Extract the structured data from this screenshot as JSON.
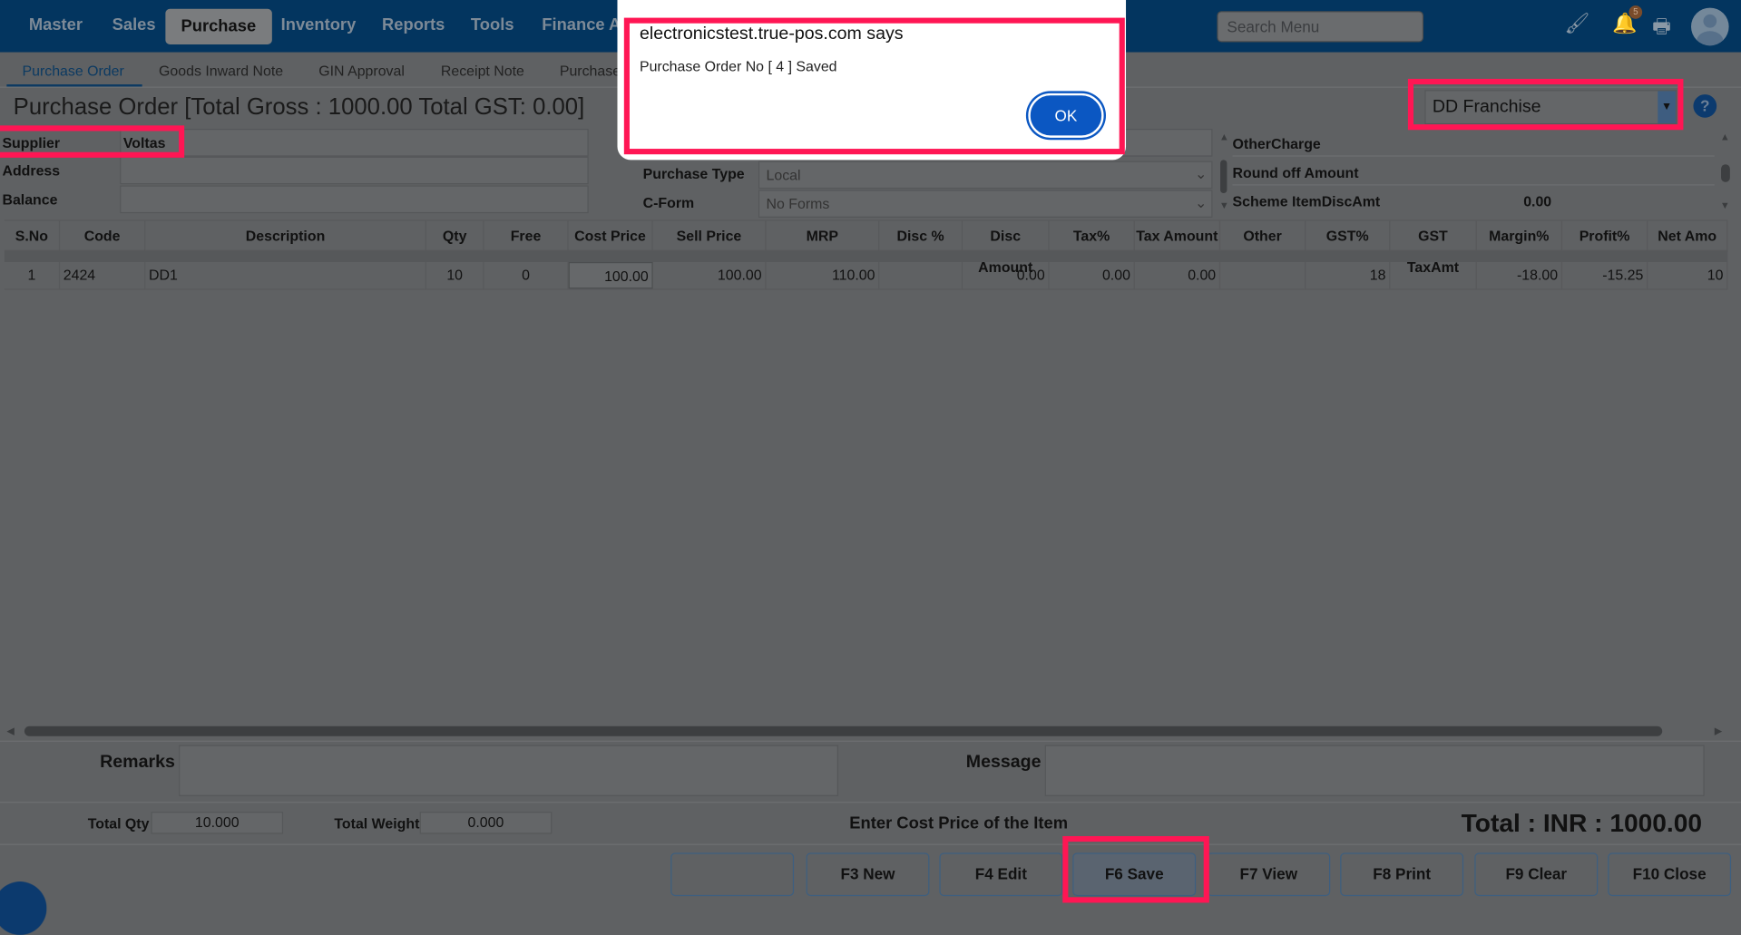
{
  "nav": {
    "items": [
      "Master",
      "Sales",
      "Purchase",
      "Inventory",
      "Reports",
      "Tools",
      "Finance An"
    ],
    "active": "Purchase",
    "search_placeholder": "Search Menu",
    "notification_count": "5"
  },
  "subnav": {
    "tabs": [
      "Purchase Order",
      "Goods Inward Note",
      "GIN Approval",
      "Receipt Note",
      "Purchase"
    ],
    "active": "Purchase Order"
  },
  "page": {
    "title": "Purchase Order [Total Gross : 1000.00 Total GST: 0.00]",
    "franchise": "DD Franchise"
  },
  "form": {
    "supplier_label": "Supplier",
    "supplier_value": "Voltas",
    "address_label": "Address",
    "balance_label": "Balance",
    "purchase_type_label": "Purchase Type",
    "purchase_type_value": "Local",
    "cform_label": "C-Form",
    "cform_value": "No Forms"
  },
  "charges": {
    "other_charge": "OtherCharge",
    "round_off": "Round off Amount",
    "scheme_disc": "Scheme ItemDiscAmt",
    "scheme_disc_value": "0.00"
  },
  "table": {
    "columns": [
      "S.No",
      "Code",
      "Description",
      "Qty",
      "Free",
      "Cost Price",
      "Sell Price",
      "MRP",
      "Disc %",
      "Disc Amount",
      "Tax%",
      "Tax Amount",
      "Other",
      "GST%",
      "GST TaxAmt",
      "Margin%",
      "Profit%",
      "Net Amo"
    ],
    "rows": [
      [
        "1",
        "2424",
        "DD1",
        "10",
        "0",
        "100.00",
        "100.00",
        "110.00",
        "",
        "0.00",
        "0.00",
        "0.00",
        "",
        "18",
        "",
        "-18.00",
        "-15.25",
        "10"
      ]
    ]
  },
  "footer": {
    "remarks_label": "Remarks",
    "message_label": "Message",
    "total_qty_label": "Total Qty",
    "total_qty": "10.000",
    "total_weight_label": "Total Weight",
    "total_weight": "0.000",
    "hint": "Enter Cost Price of the Item",
    "total": "Total : INR : 1000.00"
  },
  "buttons": [
    "",
    "F3 New",
    "F4 Edit",
    "F6 Save",
    "F7 View",
    "F8 Print",
    "F9 Clear",
    "F10 Close"
  ],
  "dialog": {
    "title": "electronicstest.true-pos.com says",
    "message": "Purchase Order No [ 4 ] Saved",
    "ok": "OK"
  },
  "colors": {
    "highlight": "#ff1654",
    "nav": "#03355f",
    "ok": "#0b57c2"
  }
}
